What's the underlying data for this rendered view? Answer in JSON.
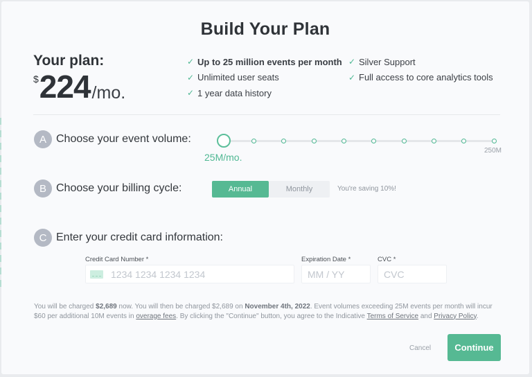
{
  "title": "Build Your Plan",
  "plan": {
    "label": "Your plan:",
    "currency": "$",
    "amount": "224",
    "period": "/mo."
  },
  "features": {
    "col1": [
      {
        "text": "Up to 25 million events per month",
        "bold": true
      },
      {
        "text": "Unlimited user seats",
        "bold": false
      },
      {
        "text": "1 year data history",
        "bold": false
      }
    ],
    "col2": [
      {
        "text": "Silver Support",
        "bold": false
      },
      {
        "text": "Full access to core analytics tools",
        "bold": false
      }
    ],
    "check_glyph": "✓"
  },
  "steps": {
    "a": {
      "badge": "A",
      "label": "Choose your event volume:"
    },
    "b": {
      "badge": "B",
      "label": "Choose your billing cycle:"
    },
    "c": {
      "badge": "C",
      "label": "Enter your credit card information:"
    }
  },
  "volume_slider": {
    "value_label": "25M/mo.",
    "max_label": "250M",
    "steps": 10,
    "selected_index": 0
  },
  "billing": {
    "options": [
      "Annual",
      "Monthly"
    ],
    "selected": "Annual",
    "saving_note": "You're saving 10%!"
  },
  "card_form": {
    "number_label": "Credit Card Number *",
    "number_placeholder": "1234 1234 1234 1234",
    "expiry_label": "Expiration Date *",
    "expiry_placeholder": "MM / YY",
    "cvc_label": "CVC *",
    "cvc_placeholder": "CVC"
  },
  "legal": {
    "p1": "You will be charged ",
    "amount_now": "$2,689",
    "p2": " now. You will then be charged $2,689 on ",
    "date": "November 4th, 2022",
    "p3": ". Event volumes exceeding 25M events per month will incur $60 per additional 10M events in ",
    "overage_link": "overage fees",
    "p4": ". By clicking the \"Continue\" button, you agree to the Indicative ",
    "tos_link": "Terms of Service",
    "p5": " and ",
    "privacy_link": "Privacy Policy",
    "p6": "."
  },
  "actions": {
    "cancel": "Cancel",
    "continue": "Continue"
  },
  "colors": {
    "accent": "#56b993",
    "badge": "#b4b9c4",
    "background": "#f9fafc"
  }
}
